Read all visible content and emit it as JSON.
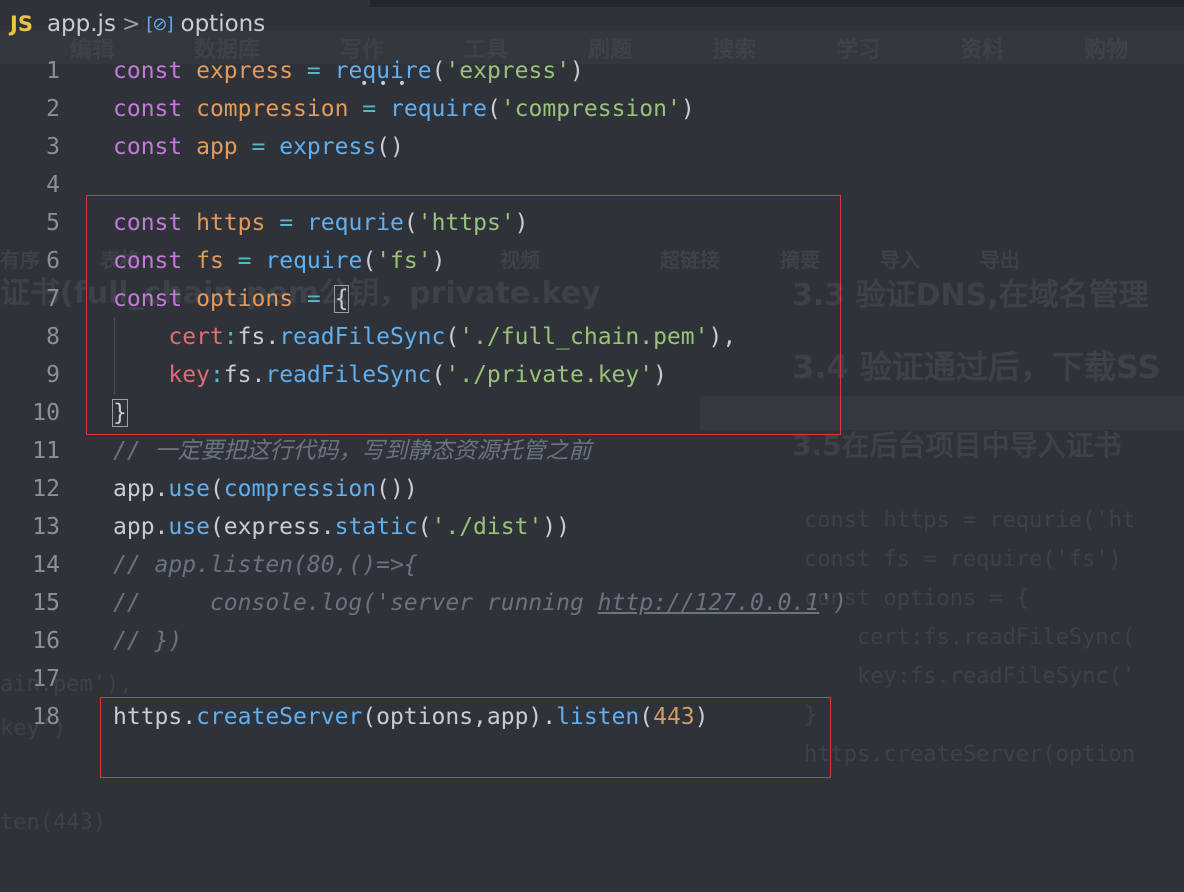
{
  "breadcrumb": {
    "file_badge": "JS",
    "file_name": "app.js",
    "separator": ">",
    "symbol_icon": "symbol-object-icon",
    "symbol_glyph": "[⊘]",
    "symbol_name": "options"
  },
  "colors": {
    "background": "#2f3239",
    "keyword": "#c678dd",
    "variable": "#e39a5b",
    "function": "#61afef",
    "string": "#98c379",
    "property": "#e06c75",
    "number": "#d19a66",
    "comment": "#6b7280",
    "highlight_box": "#e0373b"
  },
  "editor": {
    "lines": [
      {
        "n": "1",
        "tokens": [
          [
            "kw",
            "const"
          ],
          [
            "pl",
            " "
          ],
          [
            "var",
            "express"
          ],
          [
            "pl",
            " "
          ],
          [
            "op",
            "="
          ],
          [
            "pl",
            " "
          ],
          [
            "fn",
            "require"
          ],
          [
            "pl",
            "("
          ],
          [
            "str",
            "'express'"
          ],
          [
            "pl",
            ")"
          ]
        ]
      },
      {
        "n": "2",
        "tokens": [
          [
            "kw",
            "const"
          ],
          [
            "pl",
            " "
          ],
          [
            "var",
            "compression"
          ],
          [
            "pl",
            " "
          ],
          [
            "op",
            "="
          ],
          [
            "pl",
            " "
          ],
          [
            "fn",
            "require"
          ],
          [
            "pl",
            "("
          ],
          [
            "str",
            "'compression'"
          ],
          [
            "pl",
            ")"
          ]
        ]
      },
      {
        "n": "3",
        "tokens": [
          [
            "kw",
            "const"
          ],
          [
            "pl",
            " "
          ],
          [
            "var",
            "app"
          ],
          [
            "pl",
            " "
          ],
          [
            "op",
            "="
          ],
          [
            "pl",
            " "
          ],
          [
            "fn",
            "express"
          ],
          [
            "pl",
            "()"
          ]
        ]
      },
      {
        "n": "4",
        "tokens": []
      },
      {
        "n": "5",
        "tokens": [
          [
            "kw",
            "const"
          ],
          [
            "pl",
            " "
          ],
          [
            "var",
            "https"
          ],
          [
            "pl",
            " "
          ],
          [
            "op",
            "="
          ],
          [
            "pl",
            " "
          ],
          [
            "fn",
            "requrie"
          ],
          [
            "pl",
            "("
          ],
          [
            "str",
            "'https'"
          ],
          [
            "pl",
            ")"
          ]
        ]
      },
      {
        "n": "6",
        "tokens": [
          [
            "kw",
            "const"
          ],
          [
            "pl",
            " "
          ],
          [
            "var",
            "fs"
          ],
          [
            "pl",
            " "
          ],
          [
            "op",
            "="
          ],
          [
            "pl",
            " "
          ],
          [
            "fn",
            "require"
          ],
          [
            "pl",
            "("
          ],
          [
            "str",
            "'fs'"
          ],
          [
            "pl",
            ")"
          ]
        ]
      },
      {
        "n": "7",
        "tokens": [
          [
            "kw",
            "const"
          ],
          [
            "pl",
            " "
          ],
          [
            "var",
            "options"
          ],
          [
            "pl",
            " "
          ],
          [
            "op",
            "="
          ],
          [
            "pl",
            " "
          ],
          [
            "box",
            "{"
          ]
        ]
      },
      {
        "n": "8",
        "tokens": [
          [
            "pl",
            "    "
          ],
          [
            "prop",
            "cert"
          ],
          [
            "op",
            ":"
          ],
          [
            "pl",
            "fs."
          ],
          [
            "fn",
            "readFileSync"
          ],
          [
            "pl",
            "("
          ],
          [
            "str",
            "'./full_chain.pem'"
          ],
          [
            "pl",
            "),"
          ]
        ]
      },
      {
        "n": "9",
        "tokens": [
          [
            "pl",
            "    "
          ],
          [
            "prop",
            "key"
          ],
          [
            "op",
            ":"
          ],
          [
            "pl",
            "fs."
          ],
          [
            "fn",
            "readFileSync"
          ],
          [
            "pl",
            "("
          ],
          [
            "str",
            "'./private.key'"
          ],
          [
            "pl",
            ")"
          ]
        ]
      },
      {
        "n": "10",
        "tokens": [
          [
            "box",
            "}"
          ]
        ]
      },
      {
        "n": "11",
        "tokens": [
          [
            "cm",
            "// 一定要把这行代码，写到静态资源托管之前"
          ]
        ]
      },
      {
        "n": "12",
        "tokens": [
          [
            "pl",
            "app."
          ],
          [
            "fn",
            "use"
          ],
          [
            "pl",
            "("
          ],
          [
            "fn",
            "compression"
          ],
          [
            "pl",
            "())"
          ]
        ]
      },
      {
        "n": "13",
        "tokens": [
          [
            "pl",
            "app."
          ],
          [
            "fn",
            "use"
          ],
          [
            "pl",
            "(express."
          ],
          [
            "fn",
            "static"
          ],
          [
            "pl",
            "("
          ],
          [
            "str",
            "'./dist'"
          ],
          [
            "pl",
            "))"
          ]
        ]
      },
      {
        "n": "14",
        "tokens": [
          [
            "cm",
            "// app.listen(80,()=>{"
          ]
        ]
      },
      {
        "n": "15",
        "tokens": [
          [
            "cm",
            "//     console.log('server running "
          ],
          [
            "cmu",
            "http://127.0.0.1"
          ],
          [
            "cm",
            "')"
          ]
        ]
      },
      {
        "n": "16",
        "tokens": [
          [
            "cm",
            "// })"
          ]
        ]
      },
      {
        "n": "17",
        "tokens": []
      },
      {
        "n": "18",
        "tokens": [
          [
            "pl",
            "https."
          ],
          [
            "fn",
            "createServer"
          ],
          [
            "pl",
            "(options,app)."
          ],
          [
            "fn",
            "listen"
          ],
          [
            "pl",
            "("
          ],
          [
            "num",
            "443"
          ],
          [
            "pl",
            ")"
          ]
        ]
      }
    ]
  },
  "ghost": {
    "toolbar_items": [
      "编辑",
      "数据库",
      "写作",
      "工具",
      "刷题",
      "搜索",
      "学习",
      "资料",
      "购物"
    ],
    "insert_items": [
      "有序",
      "表格",
      "超链接",
      "摘要",
      "导入",
      "导出"
    ],
    "video_label": "视频",
    "headings": [
      "3.3 验证DNS,在域名管理",
      "3.4 验证通过后，下载SS",
      "3.5在后台项目中导入证书"
    ],
    "left_heading": "证书(full_chain.pem公钥，private.key",
    "code": [
      "const https = requrie('ht",
      "const fs = require('fs')",
      "const options = {",
      "    cert:fs.readFileSync(",
      "    key:fs.readFileSync('",
      "}",
      "https.createServer(option"
    ],
    "left_bits": [
      "ain.pem'),",
      "key')",
      "ten(443)"
    ]
  }
}
